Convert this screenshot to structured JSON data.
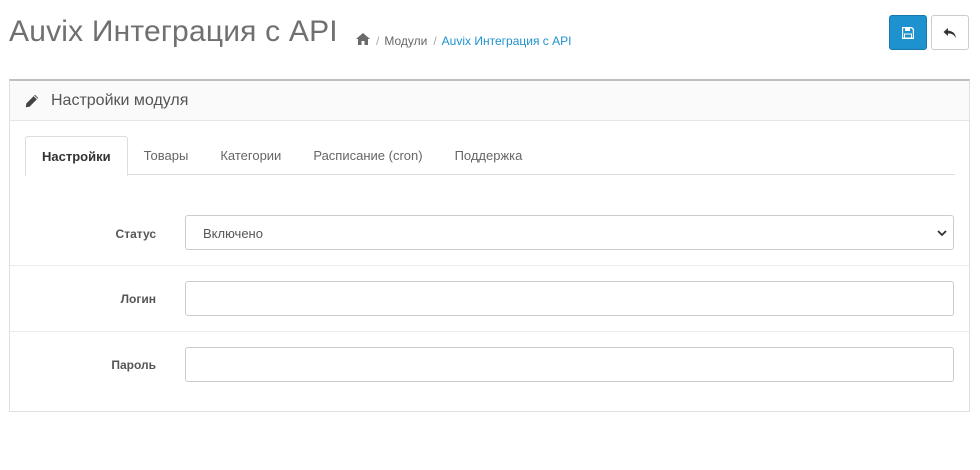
{
  "header": {
    "title": "Auvix Интеграция с API",
    "breadcrumb": {
      "home_icon": "home-icon",
      "items": [
        {
          "label": "Модули"
        },
        {
          "label": "Auvix Интеграция с API"
        }
      ],
      "separator": "/"
    },
    "buttons": {
      "save_icon": "save-icon",
      "back_icon": "reply-icon"
    }
  },
  "panel": {
    "title": "Настройки модуля",
    "icon": "pencil-icon",
    "tabs": [
      {
        "label": "Настройки",
        "active": true
      },
      {
        "label": "Товары"
      },
      {
        "label": "Категории"
      },
      {
        "label": "Расписание (cron)"
      },
      {
        "label": "Поддержка"
      }
    ],
    "fields": {
      "status": {
        "label": "Статус",
        "value": "Включено"
      },
      "login": {
        "label": "Логин",
        "value": ""
      },
      "password": {
        "label": "Пароль",
        "value": ""
      }
    }
  },
  "colors": {
    "primary": "#1e91cf",
    "link": "#1e91cf",
    "title": "#707070"
  }
}
